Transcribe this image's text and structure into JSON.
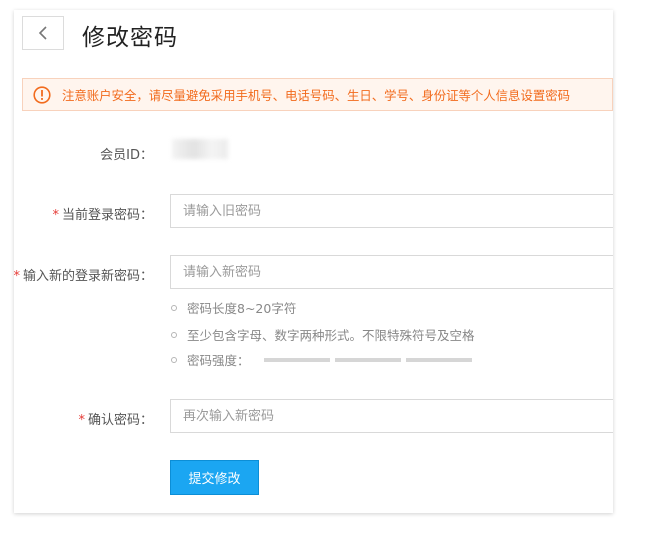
{
  "header": {
    "title": "修改密码",
    "back_icon": "chevron-left-icon"
  },
  "notice": {
    "icon": "warning-circle-icon",
    "text": "注意账户安全，请尽量避免采用手机号、电话号码、生日、学号、身份证等个人信息设置密码",
    "color": "#f26b1d",
    "background": "#fff5ee"
  },
  "form": {
    "member_id": {
      "label": "会员ID：",
      "value": ""
    },
    "current_password": {
      "required_mark": "*",
      "label": "当前登录密码：",
      "placeholder": "请输入旧密码"
    },
    "new_password": {
      "required_mark": "*",
      "label": "输入新的登录新密码：",
      "placeholder": "请输入新密码"
    },
    "rules": [
      "密码长度8~20字符",
      "至少包含字母、数字两种形式。不限特殊符号及空格",
      "密码强度："
    ],
    "strength_level": 0,
    "confirm_password": {
      "required_mark": "*",
      "label": "确认密码：",
      "placeholder": "再次输入新密码"
    },
    "submit_label": "提交修改",
    "accent_color": "#1ba6f2"
  }
}
